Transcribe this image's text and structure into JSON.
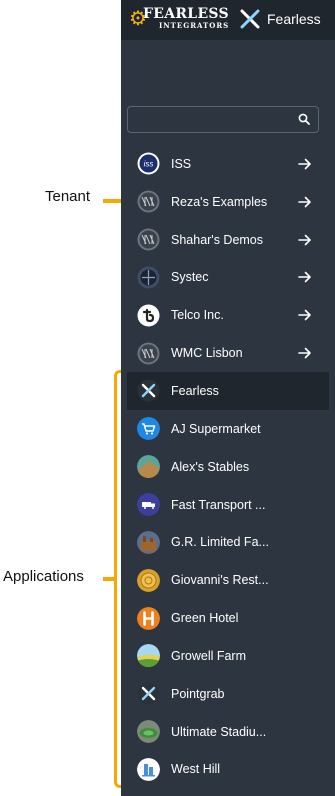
{
  "annotations": {
    "tenant_label": "Tenant",
    "applications_label": "Applications"
  },
  "header": {
    "logo_main": "FEARLESS",
    "logo_sub": "INTEGRATORS",
    "app_name": "Fearless"
  },
  "search": {
    "value": "",
    "placeholder": ""
  },
  "tenants": [
    {
      "label": "ISS",
      "icon": "iss-icon"
    },
    {
      "label": "Reza's Examples",
      "icon": "tenant-default-icon"
    },
    {
      "label": "Shahar's Demos",
      "icon": "tenant-default-icon"
    },
    {
      "label": "Systec",
      "icon": "systec-icon"
    },
    {
      "label": "Telco Inc.",
      "icon": "telco-icon"
    },
    {
      "label": "WMC Lisbon",
      "icon": "tenant-default-icon"
    }
  ],
  "applications": [
    {
      "label": "Fearless",
      "icon": "fearless-x-icon",
      "selected": true
    },
    {
      "label": "AJ Supermarket",
      "icon": "cart-icon"
    },
    {
      "label": "Alex's Stables",
      "icon": "stables-icon"
    },
    {
      "label": "Fast Transport ...",
      "icon": "truck-icon"
    },
    {
      "label": "G.R. Limited Fa...",
      "icon": "factory-icon"
    },
    {
      "label": "Giovanni's Rest...",
      "icon": "restaurant-icon"
    },
    {
      "label": "Green Hotel",
      "icon": "hotel-icon"
    },
    {
      "label": "Growell Farm",
      "icon": "farm-icon"
    },
    {
      "label": "Pointgrab",
      "icon": "pointgrab-x-icon"
    },
    {
      "label": "Ultimate Stadiu...",
      "icon": "stadium-icon"
    },
    {
      "label": "West Hill",
      "icon": "building-icon"
    }
  ],
  "colors": {
    "panel": "#2d3540",
    "topbar": "#1f262e",
    "accent": "#f5a800"
  }
}
